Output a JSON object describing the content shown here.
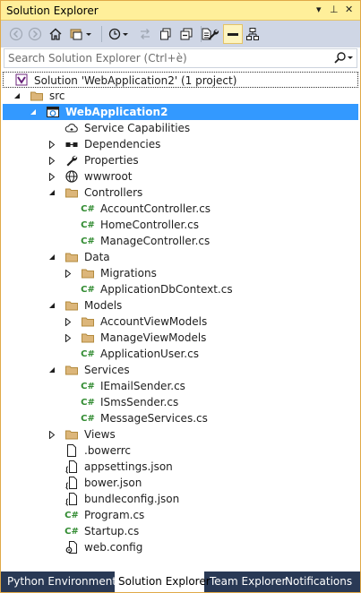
{
  "titlebar": {
    "title": "Solution Explorer",
    "dropdown_glyph": "▾",
    "pin_glyph": "⊥",
    "close_glyph": "✕"
  },
  "toolbar": {
    "buttons": [
      {
        "icon": "back-icon"
      },
      {
        "icon": "forward-icon"
      },
      {
        "icon": "home-icon"
      },
      {
        "icon": "switch-views-icon"
      },
      {
        "icon": "pending-changes-filter-icon"
      },
      {
        "icon": "sync-with-active-document-icon"
      },
      {
        "icon": "refresh-icon"
      },
      {
        "icon": "collapse-all-icon"
      },
      {
        "icon": "show-all-files-icon"
      },
      {
        "icon": "properties-icon"
      },
      {
        "icon": "preview-selected-items-icon"
      },
      {
        "icon": "class-diagram-icon"
      }
    ]
  },
  "search": {
    "placeholder": "Search Solution Explorer (Ctrl+è)",
    "search_icon": "search-icon"
  },
  "tree": {
    "items": [
      {
        "label": "Solution 'WebApplication2' (1 project)",
        "icon": "solution-icon",
        "expander": "",
        "depth": 0
      },
      {
        "label": "src",
        "icon": "folder-icon",
        "expander": "expanded",
        "depth": 1
      },
      {
        "label": "WebApplication2",
        "icon": "web-project-icon",
        "expander": "expanded",
        "depth": 2,
        "selected": true
      },
      {
        "label": "Service Capabilities",
        "icon": "cloud-icon",
        "expander": "",
        "depth": 3
      },
      {
        "label": "Dependencies",
        "icon": "dependencies-icon",
        "expander": "collapsed",
        "depth": 3
      },
      {
        "label": "Properties",
        "icon": "wrench-icon",
        "expander": "collapsed",
        "depth": 3
      },
      {
        "label": "wwwroot",
        "icon": "globe-icon",
        "expander": "collapsed",
        "depth": 3
      },
      {
        "label": "Controllers",
        "icon": "folder-icon",
        "expander": "expanded",
        "depth": 3
      },
      {
        "label": "AccountController.cs",
        "icon": "csharp-file-icon",
        "expander": "",
        "depth": 4
      },
      {
        "label": "HomeController.cs",
        "icon": "csharp-file-icon",
        "expander": "",
        "depth": 4
      },
      {
        "label": "ManageController.cs",
        "icon": "csharp-file-icon",
        "expander": "",
        "depth": 4
      },
      {
        "label": "Data",
        "icon": "folder-icon",
        "expander": "expanded",
        "depth": 3
      },
      {
        "label": "Migrations",
        "icon": "folder-icon",
        "expander": "collapsed",
        "depth": 4
      },
      {
        "label": "ApplicationDbContext.cs",
        "icon": "csharp-file-icon",
        "expander": "",
        "depth": 4
      },
      {
        "label": "Models",
        "icon": "folder-icon",
        "expander": "expanded",
        "depth": 3
      },
      {
        "label": "AccountViewModels",
        "icon": "folder-icon",
        "expander": "collapsed",
        "depth": 4
      },
      {
        "label": "ManageViewModels",
        "icon": "folder-icon",
        "expander": "collapsed",
        "depth": 4
      },
      {
        "label": "ApplicationUser.cs",
        "icon": "csharp-file-icon",
        "expander": "",
        "depth": 4
      },
      {
        "label": "Services",
        "icon": "folder-icon",
        "expander": "expanded",
        "depth": 3
      },
      {
        "label": "IEmailSender.cs",
        "icon": "csharp-file-icon",
        "expander": "",
        "depth": 4
      },
      {
        "label": "ISmsSender.cs",
        "icon": "csharp-file-icon",
        "expander": "",
        "depth": 4
      },
      {
        "label": "MessageServices.cs",
        "icon": "csharp-file-icon",
        "expander": "",
        "depth": 4
      },
      {
        "label": "Views",
        "icon": "folder-icon",
        "expander": "collapsed",
        "depth": 3
      },
      {
        "label": ".bowerrc",
        "icon": "file-icon",
        "expander": "",
        "depth": 3
      },
      {
        "label": "appsettings.json",
        "icon": "json-file-icon",
        "expander": "",
        "depth": 3
      },
      {
        "label": "bower.json",
        "icon": "json-file-icon",
        "expander": "",
        "depth": 3
      },
      {
        "label": "bundleconfig.json",
        "icon": "json-file-icon",
        "expander": "",
        "depth": 3
      },
      {
        "label": "Program.cs",
        "icon": "csharp-file-icon",
        "expander": "",
        "depth": 3
      },
      {
        "label": "Startup.cs",
        "icon": "csharp-file-icon",
        "expander": "",
        "depth": 3
      },
      {
        "label": "web.config",
        "icon": "config-file-icon",
        "expander": "",
        "depth": 3
      }
    ]
  },
  "tabs": [
    {
      "label": "Python Environments",
      "active": false
    },
    {
      "label": "Solution Explorer",
      "active": true
    },
    {
      "label": "Team Explorer",
      "active": false
    },
    {
      "label": "Notifications",
      "active": false
    }
  ],
  "colors": {
    "titlebar": "#ffef9a",
    "toolbar": "#cfd6e5",
    "selection": "#3399ff",
    "tab_strip": "#293955",
    "csharp_icon": "#2f8a2f",
    "folder_icon": "#dcb67a"
  }
}
